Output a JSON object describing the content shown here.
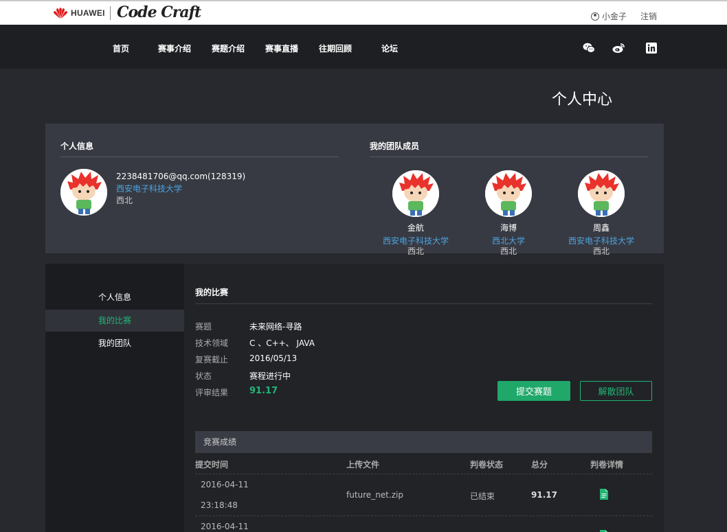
{
  "header": {
    "brand": "HUAWEI",
    "product": "Code Craft",
    "user_name": "小金子",
    "logout": "注销"
  },
  "nav": {
    "items": [
      "首页",
      "赛事介绍",
      "赛题介绍",
      "赛事直播",
      "往期回顾",
      "论坛"
    ],
    "social_icons": [
      "wechat-icon",
      "weibo-icon",
      "linkedin-icon"
    ]
  },
  "page_title": "个人中心",
  "personal_info": {
    "heading": "个人信息",
    "email": "2238481706@qq.com(128319)",
    "school": "西安电子科技大学",
    "region": "西北"
  },
  "team": {
    "heading": "我的团队成员",
    "members": [
      {
        "name": "金航",
        "school": "西安电子科技大学",
        "region": "西北"
      },
      {
        "name": "海博",
        "school": "西北大学",
        "region": "西北"
      },
      {
        "name": "周鑫",
        "school": "西安电子科技大学",
        "region": "西北"
      }
    ]
  },
  "sidebar": {
    "items": [
      "个人信息",
      "我的比赛",
      "我的团队"
    ],
    "active": "我的比赛"
  },
  "competition": {
    "heading": "我的比赛",
    "fields": [
      {
        "label": "赛题",
        "value": "未来网络-寻路"
      },
      {
        "label": "技术领域",
        "value": "C 、C++、 JAVA"
      },
      {
        "label": "复赛截止",
        "value": "2016/05/13"
      },
      {
        "label": "状态",
        "value": "赛程进行中"
      },
      {
        "label": "评审结果",
        "value": "91.17"
      }
    ],
    "submit_button": "提交赛题",
    "disband_button": "解散团队"
  },
  "results": {
    "title": "竞赛成绩",
    "columns": [
      "提交时间",
      "上传文件",
      "判卷状态",
      "总分",
      "判卷详情"
    ],
    "rows": [
      {
        "date": "2016-04-11",
        "time": "23:18:48",
        "file": "future_net.zip",
        "status": "已结束",
        "score": "91.17"
      },
      {
        "date": "2016-04-11"
      }
    ]
  },
  "colors": {
    "accent": "#23b576",
    "link": "#4da3e0",
    "background": "#27292e"
  }
}
